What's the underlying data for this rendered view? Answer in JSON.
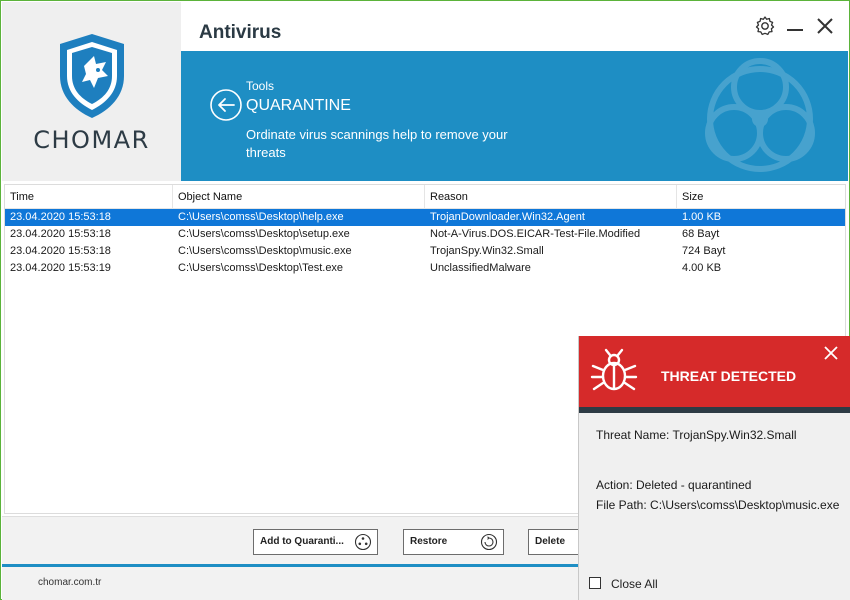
{
  "app": {
    "brand": "CHOMAR",
    "title": "Antivirus"
  },
  "header": {
    "breadcrumb": "Tools",
    "page_title": "QUARANTINE",
    "description": "Ordinate virus scannings help to remove your threats"
  },
  "table": {
    "columns": [
      "Time",
      "Object Name",
      "Reason",
      "Size"
    ],
    "rows": [
      {
        "time": "23.04.2020 15:53:18",
        "object": "C:\\Users\\comss\\Desktop\\help.exe",
        "reason": "TrojanDownloader.Win32.Agent",
        "size": "1.00 KB",
        "selected": true
      },
      {
        "time": "23.04.2020 15:53:18",
        "object": "C:\\Users\\comss\\Desktop\\setup.exe",
        "reason": "Not-A-Virus.DOS.EICAR-Test-File.Modified",
        "size": "68 Bayt",
        "selected": false
      },
      {
        "time": "23.04.2020 15:53:18",
        "object": "C:\\Users\\comss\\Desktop\\music.exe",
        "reason": "TrojanSpy.Win32.Small",
        "size": "724 Bayt",
        "selected": false
      },
      {
        "time": "23.04.2020 15:53:19",
        "object": "C:\\Users\\comss\\Desktop\\Test.exe",
        "reason": "UnclassifiedMalware",
        "size": "4.00 KB",
        "selected": false
      }
    ]
  },
  "buttons": {
    "add_to_quarantine": "Add to Quaranti...",
    "restore": "Restore",
    "delete": "Delete"
  },
  "footer": {
    "url": "chomar.com.tr"
  },
  "threat_popup": {
    "title": "THREAT DETECTED",
    "threat_name": "Threat Name: TrojanSpy.Win32.Small",
    "action": "Action: Deleted - quarantined",
    "file_path": "File Path: C:\\Users\\comss\\Desktop\\music.exe",
    "close_all_label": "Close All",
    "close_all_checked": false
  },
  "colors": {
    "accent": "#1e8ec4",
    "threat": "#d62a2a",
    "selection": "#0f77d8",
    "brand_dark": "#2d3b45",
    "window_border": "#5bb33a"
  },
  "icons": [
    "shield-logo",
    "gear-icon",
    "minimize-icon",
    "close-icon",
    "back-arrow-icon",
    "biohazard-watermark",
    "bug-icon",
    "quarantine-icon",
    "restore-icon"
  ]
}
